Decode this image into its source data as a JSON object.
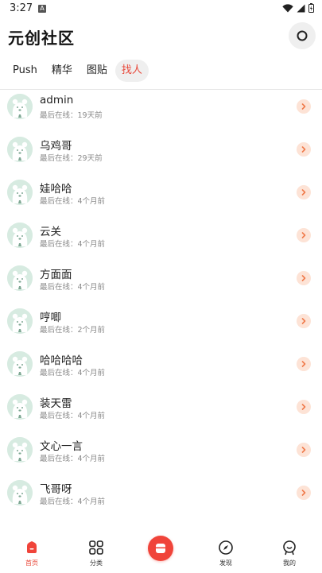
{
  "status_bar": {
    "time": "3:27",
    "notification_glyph": "A"
  },
  "header": {
    "title": "元创社区",
    "search_icon": "search-icon"
  },
  "tabs": [
    {
      "label": "Push",
      "active": false
    },
    {
      "label": "精华",
      "active": false
    },
    {
      "label": "图贴",
      "active": false
    },
    {
      "label": "找人",
      "active": true
    }
  ],
  "users": [
    {
      "name": "admin",
      "status": "最后在线：19天前"
    },
    {
      "name": "乌鸡哥",
      "status": "最后在线：29天前"
    },
    {
      "name": "娃哈哈",
      "status": "最后在线：4个月前"
    },
    {
      "name": "云关",
      "status": "最后在线：4个月前"
    },
    {
      "name": "方面面",
      "status": "最后在线：4个月前"
    },
    {
      "name": "哼唧",
      "status": "最后在线：2个月前"
    },
    {
      "name": "哈哈哈哈",
      "status": "最后在线：4个月前"
    },
    {
      "name": "装天雷",
      "status": "最后在线：4个月前"
    },
    {
      "name": "文心一言",
      "status": "最后在线：4个月前"
    },
    {
      "name": "飞哥呀",
      "status": "最后在线：4个月前"
    }
  ],
  "bottom_nav": {
    "home": "首页",
    "category": "分类",
    "center_icon": "store-icon",
    "discover": "发现",
    "mine": "我的"
  },
  "colors": {
    "accent": "#e8483a",
    "avatar_bg": "#d7ebe1",
    "arrow_bg": "#fde3d6",
    "tab_active_bg": "#efefef"
  }
}
